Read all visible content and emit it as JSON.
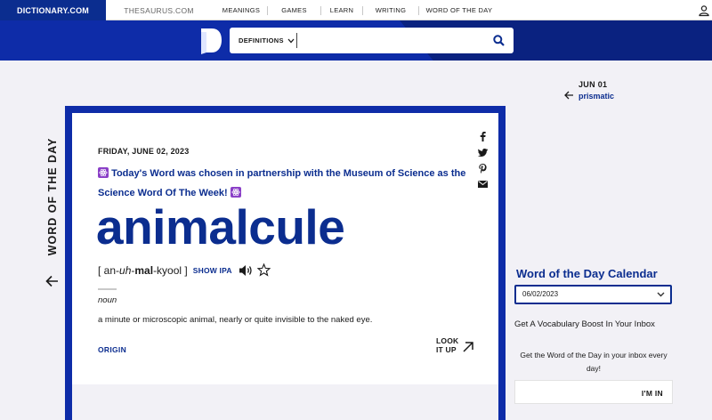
{
  "topnav": {
    "brand": "DICTIONARY.COM",
    "thesaurus": "THESAURUS.COM",
    "items": [
      "MEANINGS",
      "GAMES",
      "LEARN",
      "WRITING",
      "WORD OF THE DAY"
    ]
  },
  "search": {
    "dropdown_label": "DEFINITIONS",
    "value": "",
    "placeholder": ""
  },
  "previous": {
    "date": "JUN 01",
    "word": "prismatic"
  },
  "section_title": "WORD OF THE DAY",
  "card": {
    "date": "FRIDAY, JUNE 02, 2023",
    "partner_text": "Today's Word was chosen in partnership with the Museum of Science as the Science Word Of The Week!",
    "word": "animalcule",
    "pron_open": "[ an-",
    "pron_uh": "uh",
    "pron_dash": "-",
    "pron_mal": "mal",
    "pron_rest": "-kyool ]",
    "show_ipa": "SHOW IPA",
    "part_of_speech": "noun",
    "definition": "a minute or microscopic animal, nearly or quite invisible to the naked eye.",
    "origin": "ORIGIN",
    "look_it_up_1": "LOOK",
    "look_it_up_2": "IT UP"
  },
  "calendar": {
    "title": "Word of the Day Calendar",
    "selected": "06/02/2023"
  },
  "newsletter": {
    "heading": "Get A Vocabulary Boost In Your Inbox",
    "text": "Get the Word of the Day in your inbox every day!",
    "email_value": "",
    "button": "I'M IN"
  },
  "colors": {
    "brand_blue": "#0e2ca8",
    "link_blue": "#0b2d8f",
    "background": "#f2f1f6",
    "atom_purple": "#8a3fc7"
  },
  "icons": [
    "user-icon",
    "logo-icon",
    "chevron-down-icon",
    "search-icon",
    "arrow-left-icon",
    "facebook-icon",
    "twitter-icon",
    "pinterest-icon",
    "email-icon",
    "atom-emoji-icon",
    "speaker-icon",
    "star-icon",
    "arrow-up-right-icon"
  ]
}
